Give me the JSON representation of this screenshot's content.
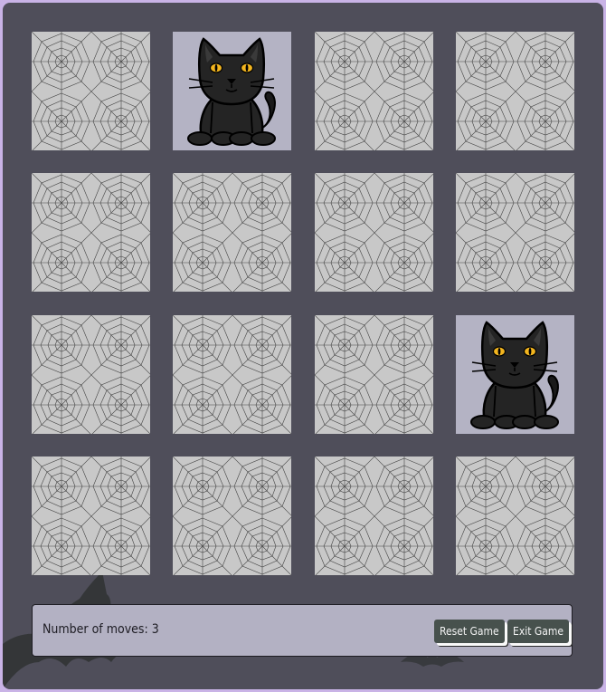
{
  "game": {
    "cards": [
      {
        "state": "face-down"
      },
      {
        "state": "face-up",
        "symbol": "black-cat"
      },
      {
        "state": "face-down"
      },
      {
        "state": "face-down"
      },
      {
        "state": "face-down"
      },
      {
        "state": "face-down"
      },
      {
        "state": "face-down"
      },
      {
        "state": "face-down"
      },
      {
        "state": "face-down"
      },
      {
        "state": "face-down"
      },
      {
        "state": "face-down"
      },
      {
        "state": "face-up",
        "symbol": "black-cat"
      },
      {
        "state": "face-down"
      },
      {
        "state": "face-down"
      },
      {
        "state": "face-down"
      },
      {
        "state": "face-down"
      }
    ]
  },
  "footer": {
    "moves_label": "Number of moves: 3",
    "reset_label": "Reset Game",
    "exit_label": "Exit Game"
  },
  "colors": {
    "page_bg": "#c9b3e6",
    "board_bg": "#4f4e5a",
    "card_back": "#c8c8c8",
    "card_face": "#b4b3c4",
    "footer_bg": "#b3b1c3",
    "button_bg": "#47514d"
  }
}
